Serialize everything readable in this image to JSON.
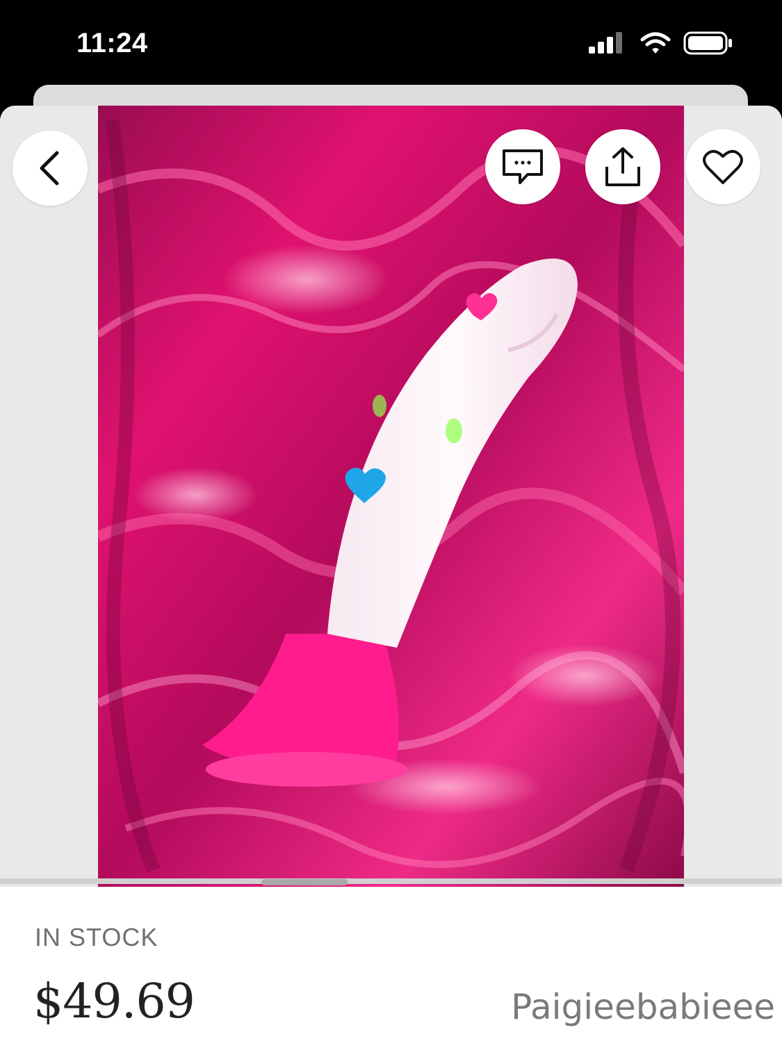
{
  "status_bar": {
    "time": "11:24",
    "icons": [
      "cellular-signal-icon",
      "wifi-icon",
      "battery-icon"
    ]
  },
  "toolbar": {
    "back_icon": "chevron-left-icon",
    "message_icon": "message-bubble-icon",
    "share_icon": "share-icon",
    "favorite_icon": "heart-outline-icon"
  },
  "product": {
    "stock_status": "IN STOCK",
    "price": "$49.69",
    "seller": "Paigieebabieee"
  },
  "colors": {
    "background": "#000000",
    "accent_pink": "#e0126f",
    "text_muted": "#707070"
  }
}
